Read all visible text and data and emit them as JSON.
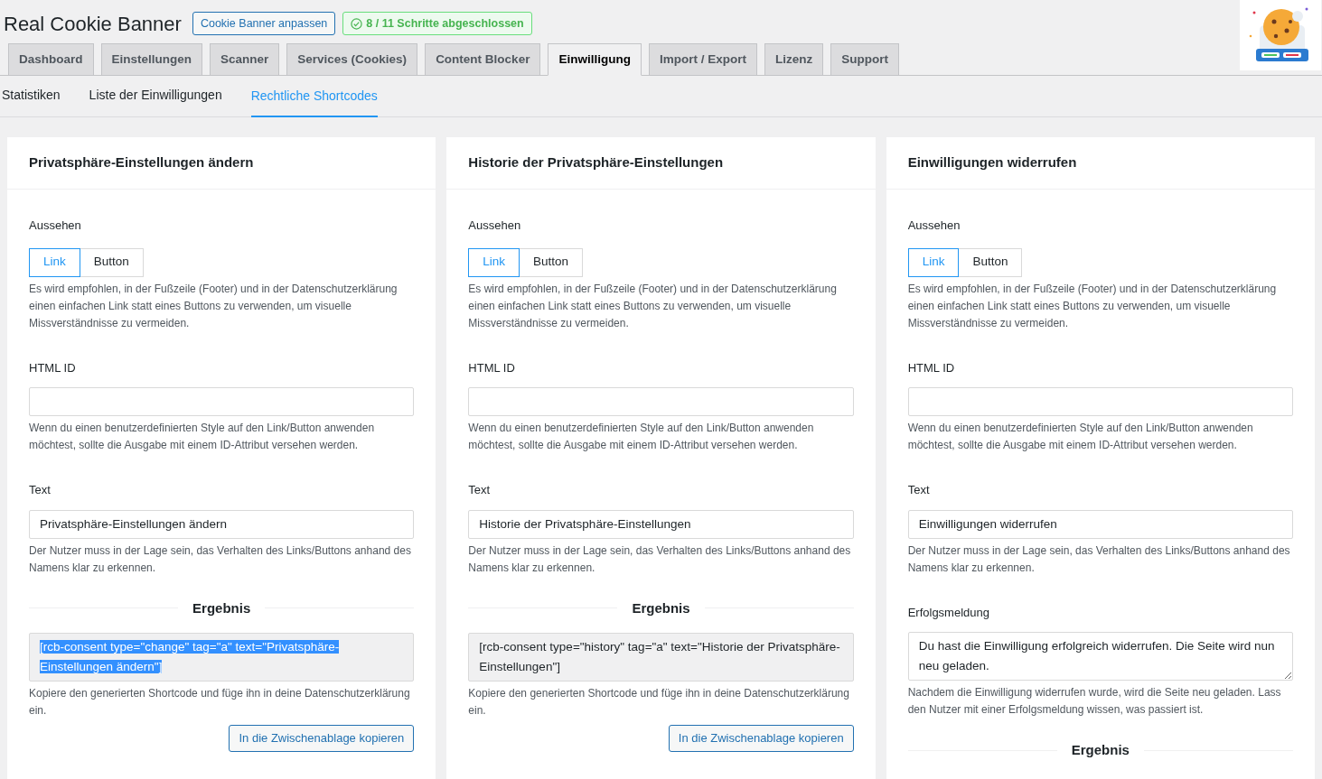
{
  "header": {
    "title": "Real Cookie Banner",
    "customize_button": "Cookie Banner anpassen",
    "progress_badge": "8 / 11 Schritte abgeschlossen"
  },
  "tabs": [
    {
      "label": "Dashboard",
      "selected": false
    },
    {
      "label": "Einstellungen",
      "selected": false
    },
    {
      "label": "Scanner",
      "selected": false
    },
    {
      "label": "Services (Cookies)",
      "selected": false
    },
    {
      "label": "Content Blocker",
      "selected": false
    },
    {
      "label": "Einwilligung",
      "selected": true
    },
    {
      "label": "Import / Export",
      "selected": false
    },
    {
      "label": "Lizenz",
      "selected": false
    },
    {
      "label": "Support",
      "selected": false
    }
  ],
  "subtabs": [
    {
      "label": "Statistiken",
      "selected": false
    },
    {
      "label": "Liste der Einwilligungen",
      "selected": false
    },
    {
      "label": "Rechtliche Shortcodes",
      "selected": true
    }
  ],
  "cards": [
    {
      "title": "Privatsphäre-Einstellungen ändern",
      "appearance_label": "Aussehen",
      "appearance_options": [
        {
          "label": "Link",
          "selected": true
        },
        {
          "label": "Button",
          "selected": false
        }
      ],
      "appearance_help": "Es wird empfohlen, in der Fußzeile (Footer) und in der Datenschutzerklärung einen einfachen Link statt eines Buttons zu verwenden, um visuelle Missverständnisse zu vermeiden.",
      "html_id_label": "HTML ID",
      "html_id_help": "Wenn du einen benutzerdefinierten Style auf den Link/Button anwenden möchtest, sollte die Ausgabe mit einem ID-Attribut versehen werden.",
      "text_label": "Text",
      "text_value": "Privatsphäre-Einstellungen ändern",
      "text_help": "Der Nutzer muss in der Lage sein, das Verhalten des Links/Buttons anhand des Namens klar zu erkennen.",
      "result_heading": "Ergebnis",
      "shortcode": "[rcb-consent type=\"change\" tag=\"a\" text=\"Privatsphäre-Einstellungen ändern\"]",
      "shortcode_highlighted": true,
      "shortcode_help": "Kopiere den generierten Shortcode und füge ihn in deine Datenschutzerklärung ein.",
      "copy_button": "In die Zwischenablage kopieren"
    },
    {
      "title": "Historie der Privatsphäre-Einstellungen",
      "appearance_label": "Aussehen",
      "appearance_options": [
        {
          "label": "Link",
          "selected": true
        },
        {
          "label": "Button",
          "selected": false
        }
      ],
      "appearance_help": "Es wird empfohlen, in der Fußzeile (Footer) und in der Datenschutzerklärung einen einfachen Link statt eines Buttons zu verwenden, um visuelle Missverständnisse zu vermeiden.",
      "html_id_label": "HTML ID",
      "html_id_help": "Wenn du einen benutzerdefinierten Style auf den Link/Button anwenden möchtest, sollte die Ausgabe mit einem ID-Attribut versehen werden.",
      "text_label": "Text",
      "text_value": "Historie der Privatsphäre-Einstellungen",
      "text_help": "Der Nutzer muss in der Lage sein, das Verhalten des Links/Buttons anhand des Namens klar zu erkennen.",
      "result_heading": "Ergebnis",
      "shortcode": "[rcb-consent type=\"history\" tag=\"a\" text=\"Historie der Privatsphäre-Einstellungen\"]",
      "shortcode_highlighted": false,
      "shortcode_help": "Kopiere den generierten Shortcode und füge ihn in deine Datenschutzerklärung ein.",
      "copy_button": "In die Zwischenablage kopieren"
    },
    {
      "title": "Einwilligungen widerrufen",
      "appearance_label": "Aussehen",
      "appearance_options": [
        {
          "label": "Link",
          "selected": true
        },
        {
          "label": "Button",
          "selected": false
        }
      ],
      "appearance_help": "Es wird empfohlen, in der Fußzeile (Footer) und in der Datenschutzerklärung einen einfachen Link statt eines Buttons zu verwenden, um visuelle Missverständnisse zu vermeiden.",
      "html_id_label": "HTML ID",
      "html_id_help": "Wenn du einen benutzerdefinierten Style auf den Link/Button anwenden möchtest, sollte die Ausgabe mit einem ID-Attribut versehen werden.",
      "text_label": "Text",
      "text_value": "Einwilligungen widerrufen",
      "text_help": "Der Nutzer muss in der Lage sein, das Verhalten des Links/Buttons anhand des Namens klar zu erkennen.",
      "success_label": "Erfolgsmeldung",
      "success_value": "Du hast die Einwilligung erfolgreich widerrufen. Die Seite wird nun neu geladen.",
      "success_help": "Nachdem die Einwilligung widerrufen wurde, wird die Seite neu geladen. Lass den Nutzer mit einer Erfolgsmeldung wissen, was passiert ist.",
      "result_heading": "Ergebnis"
    }
  ]
}
